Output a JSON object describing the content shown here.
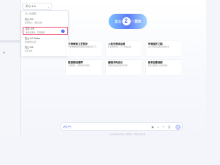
{
  "model_selector": {
    "label": "文心 4.5",
    "chevron": "chevron-down-icon"
  },
  "dropdown": {
    "items": [
      {
        "name": "文心大模型",
        "desc": ""
      },
      {
        "name": "文心 4.0",
        "desc": "更强能力，更多功能"
      },
      {
        "name": "文心 4.5",
        "desc": "多模态理解，更强推理"
      },
      {
        "name": "文心 4.0 Turbo",
        "desc": "更快响应速度"
      },
      {
        "name": "文心 3.5",
        "desc": "免费使用"
      }
    ]
  },
  "logo": {
    "left": "文心",
    "num": "2",
    "right": "一周年"
  },
  "cards": [
    {
      "title": "文物修复工艺赏析",
      "desc": "介绍文物修复的基本流程和常见工艺"
    },
    {
      "title": "人民日报读后感",
      "desc": "结合热点时评，写一篇读后感"
    },
    {
      "title": "环境保护之路",
      "desc": "探讨可持续发展的实践方式"
    },
    {
      "title": "旅游规划推荐",
      "desc": "为我规划一次周末出行路线"
    },
    {
      "title": "编程代码优化",
      "desc": "帮我优化这段代码的性能"
    },
    {
      "title": "高考志愿填报",
      "desc": "根据分数推荐合适的院校"
    }
  ],
  "input": {
    "tag": "文心 4.5",
    "placeholder": ""
  },
  "footer": "以上内容均由AI生成，仅供参考，不代表百度立场"
}
